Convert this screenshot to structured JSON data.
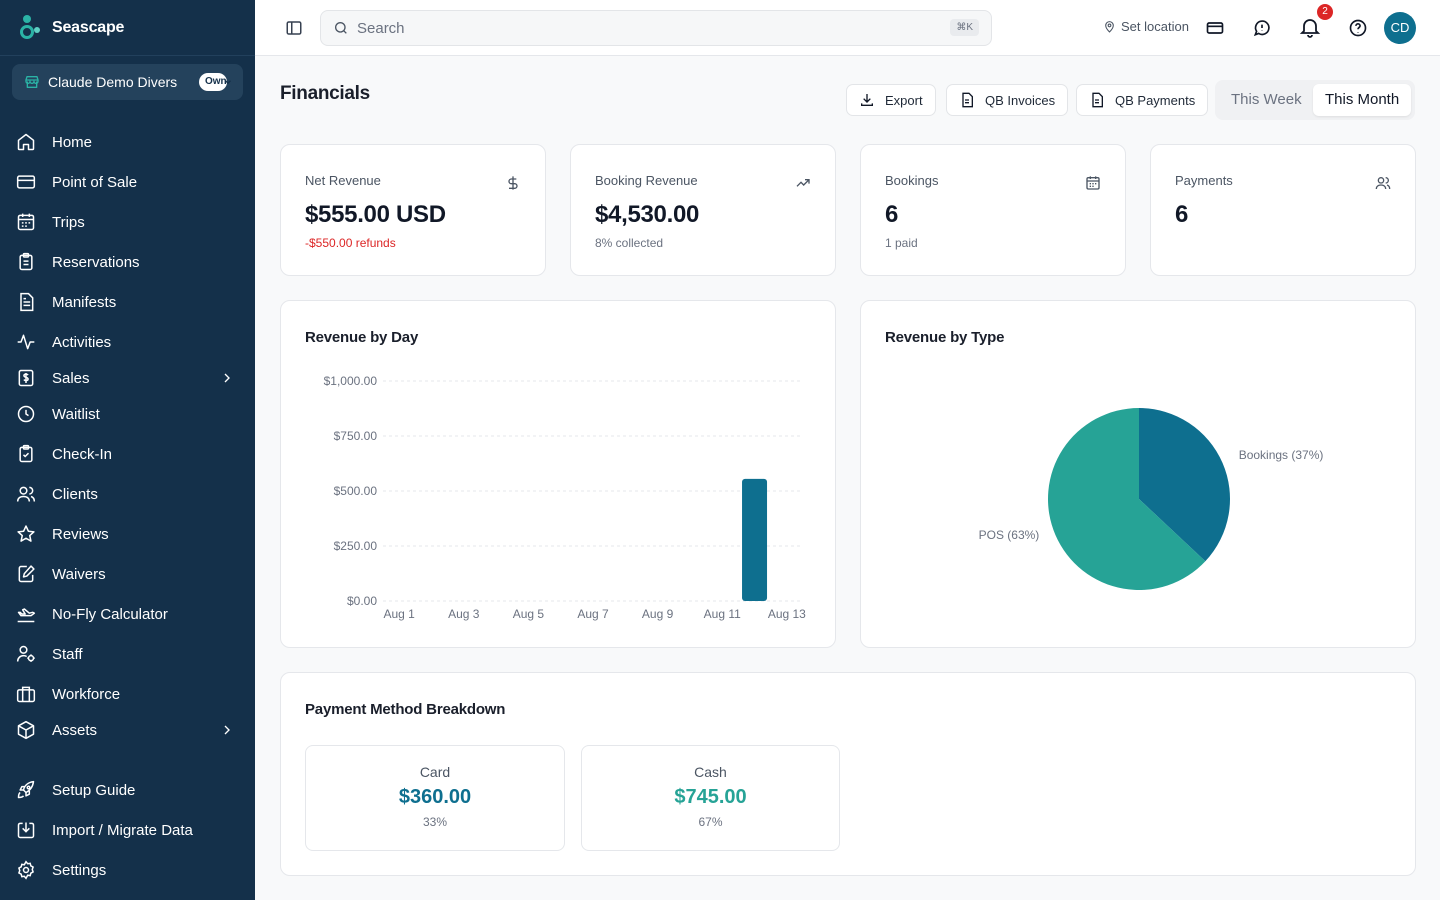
{
  "brand": {
    "name": "Seascape"
  },
  "org": {
    "name": "Claude Demo Divers",
    "role_badge": "Owner"
  },
  "sidebar": {
    "items": [
      {
        "label": "Home",
        "icon": "home-icon"
      },
      {
        "label": "Point of Sale",
        "icon": "credit-card-icon"
      },
      {
        "label": "Trips",
        "icon": "calendar-icon"
      },
      {
        "label": "Reservations",
        "icon": "clipboard-icon"
      },
      {
        "label": "Manifests",
        "icon": "document-icon"
      },
      {
        "label": "Activities",
        "icon": "activity-icon"
      },
      {
        "label": "Sales",
        "icon": "receipt-dollar-icon",
        "expandable": true
      },
      {
        "label": "Waitlist",
        "icon": "clock-icon"
      },
      {
        "label": "Check-In",
        "icon": "clipboard-check-icon"
      },
      {
        "label": "Clients",
        "icon": "users-icon"
      },
      {
        "label": "Reviews",
        "icon": "star-icon"
      },
      {
        "label": "Waivers",
        "icon": "file-signature-icon"
      },
      {
        "label": "No-Fly Calculator",
        "icon": "plane-icon"
      },
      {
        "label": "Staff",
        "icon": "user-cog-icon"
      },
      {
        "label": "Workforce",
        "icon": "briefcase-icon"
      },
      {
        "label": "Assets",
        "icon": "box-icon",
        "expandable": true
      },
      {
        "label": "Setup Guide",
        "icon": "rocket-icon"
      },
      {
        "label": "Import / Migrate Data",
        "icon": "import-icon"
      },
      {
        "label": "Settings",
        "icon": "gear-icon"
      }
    ]
  },
  "topbar": {
    "search_placeholder": "Search",
    "search_shortcut": "⌘K",
    "set_location": "Set location",
    "notification_count": "2",
    "avatar_initials": "CD"
  },
  "page": {
    "title": "Financials",
    "buttons": {
      "export": "Export",
      "qb_invoices": "QB Invoices",
      "qb_payments": "QB Payments"
    },
    "range": {
      "week": "This Week",
      "month": "This Month",
      "selected": "This Month"
    }
  },
  "stats": [
    {
      "label": "Net Revenue",
      "value": "$555.00 USD",
      "sub": "-$550.00 refunds",
      "icon": "dollar-icon"
    },
    {
      "label": "Booking Revenue",
      "value": "$4,530.00",
      "sub": "8% collected",
      "icon": "trending-up-icon"
    },
    {
      "label": "Bookings",
      "value": "6",
      "sub": "1 paid",
      "icon": "calendar-icon"
    },
    {
      "label": "Payments",
      "value": "6",
      "sub": "",
      "icon": "users-icon"
    }
  ],
  "revenue_by_day": {
    "title": "Revenue by Day"
  },
  "revenue_by_type": {
    "title": "Revenue by Type"
  },
  "chart_data": [
    {
      "type": "bar",
      "title": "Revenue by Day",
      "categories": [
        "Aug 1",
        "Aug 2",
        "Aug 3",
        "Aug 4",
        "Aug 5",
        "Aug 6",
        "Aug 7",
        "Aug 8",
        "Aug 9",
        "Aug 10",
        "Aug 11",
        "Aug 12",
        "Aug 13"
      ],
      "x_tick_labels": [
        "Aug 1",
        "Aug 3",
        "Aug 5",
        "Aug 7",
        "Aug 9",
        "Aug 11",
        "Aug 13"
      ],
      "values": [
        0,
        0,
        0,
        0,
        0,
        0,
        0,
        0,
        0,
        0,
        0,
        555,
        0
      ],
      "y_ticks": [
        "$0.00",
        "$250.00",
        "$500.00",
        "$750.00",
        "$1,000.00"
      ],
      "ylim": [
        0,
        1000
      ],
      "grid": true,
      "color": "#0e6f8f"
    },
    {
      "type": "pie",
      "title": "Revenue by Type",
      "slices": [
        {
          "label": "Bookings (37%)",
          "value": 37,
          "color": "#0e6f8f"
        },
        {
          "label": "POS (63%)",
          "value": 63,
          "color": "#26a396"
        }
      ]
    }
  ],
  "payment_breakdown": {
    "title": "Payment Method Breakdown",
    "methods": [
      {
        "name": "Card",
        "amount": "$360.00",
        "pct": "33%",
        "color": "#0e6f8f"
      },
      {
        "name": "Cash",
        "amount": "$745.00",
        "pct": "67%",
        "color": "#26a396"
      }
    ]
  }
}
